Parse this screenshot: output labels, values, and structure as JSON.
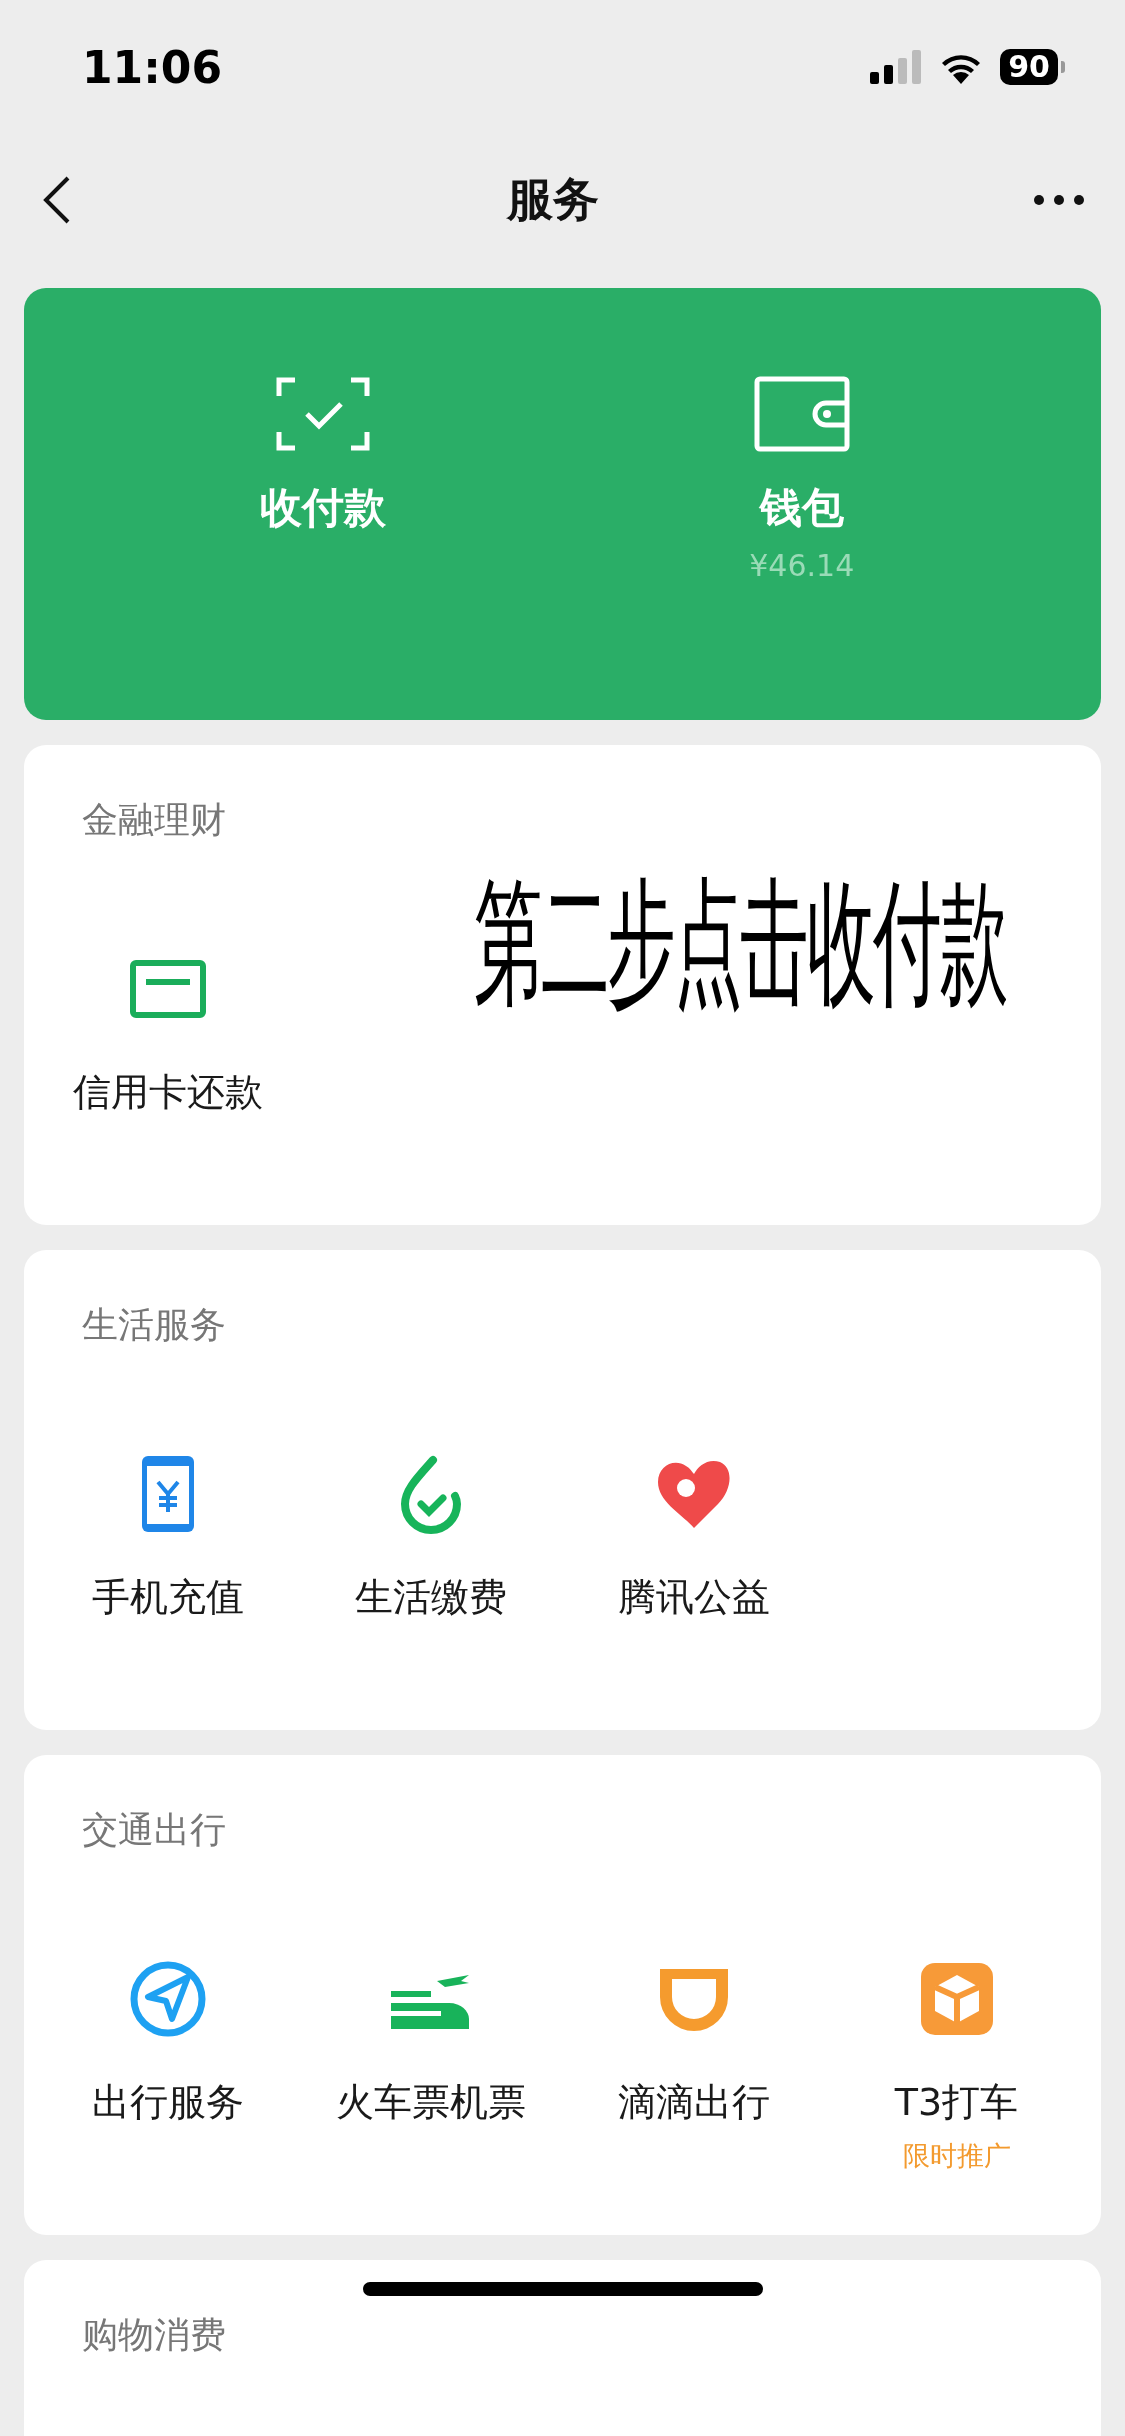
{
  "status_bar": {
    "time": "11:06",
    "battery": "90"
  },
  "nav": {
    "title": "服务"
  },
  "wallet_card": {
    "items": [
      {
        "kind": "pay",
        "label": "收付款"
      },
      {
        "kind": "wallet",
        "label": "钱包",
        "balance": "¥46.14"
      }
    ]
  },
  "sections": [
    {
      "title": "金融理财",
      "annotation": "第二步点击收付款",
      "items": [
        {
          "kind": "card",
          "label": "信用卡还款"
        }
      ]
    },
    {
      "title": "生活服务",
      "items": [
        {
          "kind": "phone",
          "label": "手机充值"
        },
        {
          "kind": "bill",
          "label": "生活缴费"
        },
        {
          "kind": "heart",
          "label": "腾讯公益"
        }
      ]
    },
    {
      "title": "交通出行",
      "items": [
        {
          "kind": "compass",
          "label": "出行服务"
        },
        {
          "kind": "train",
          "label": "火车票机票"
        },
        {
          "kind": "didi",
          "label": "滴滴出行"
        },
        {
          "kind": "t3",
          "label": "T3打车",
          "promo": "限时推广"
        }
      ]
    },
    {
      "title": "购物消费"
    }
  ]
}
